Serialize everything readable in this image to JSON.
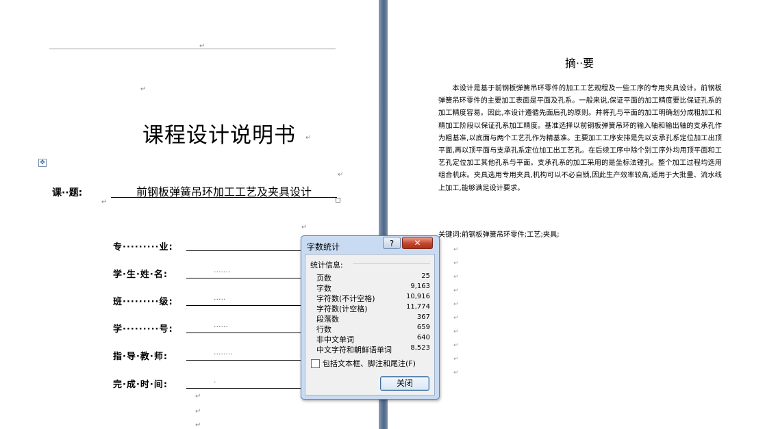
{
  "left_page": {
    "title": "课程设计说明书",
    "topic_label": "课··题:",
    "topic_value": "前钢板弹簧吊环加工工艺及夹具设计",
    "fields": [
      {
        "label": "专·········业:",
        "dots": ""
      },
      {
        "label": "学·生·姓·名:",
        "dots": "·······"
      },
      {
        "label": "班·········级:",
        "dots": "·····"
      },
      {
        "label": "学·········号:",
        "dots": "······"
      },
      {
        "label": "指·导·教·师:",
        "dots": "········"
      },
      {
        "label": "完·成·时·间:",
        "dots": "·"
      }
    ]
  },
  "right_page": {
    "abstract_title": "摘··要",
    "abstract_body": "本设计是基于前钢板弹簧吊环零件的加工工艺规程及一些工序的专用夹具设计。前钢板弹簧吊环零件的主要加工表面是平面及孔系。一般来说,保证平面的加工精度要比保证孔系的加工精度容易。因此,本设计遵循先面后孔的原则。并将孔与平面的加工明确划分成粗加工和精加工阶段以保证孔系加工精度。基准选择以前钢板弹簧吊环的输入轴和输出轴的支承孔作为粗基准,以底面与两个工艺孔作为精基准。主要加工工序安排是先以支承孔系定位加工出顶平面,再以顶平面与支承孔系定位加工出工艺孔。在后续工序中除个别工序外均用顶平面和工艺孔定位加工其他孔系与平面。支承孔系的加工采用的是坐标法镗孔。整个加工过程均选用组合机床。夹具选用专用夹具,机构可以不必自锁,因此生产效率较高,适用于大批量、流水线上加工,能够满足设计要求。",
    "keywords": "关键词:前钢板弹簧吊环零件;工艺;夹具;"
  },
  "dialog": {
    "title": "字数统计",
    "help_label": "?",
    "close_x": "✕",
    "group_label": "统计信息:",
    "stats": [
      {
        "label": "页数",
        "value": "25"
      },
      {
        "label": "字数",
        "value": "9,163"
      },
      {
        "label": "字符数(不计空格)",
        "value": "10,916"
      },
      {
        "label": "字符数(计空格)",
        "value": "11,774"
      },
      {
        "label": "段落数",
        "value": "367"
      },
      {
        "label": "行数",
        "value": "659"
      },
      {
        "label": "非中文单词",
        "value": "640"
      },
      {
        "label": "中文字符和朝鲜语单词",
        "value": "8,523"
      }
    ],
    "checkbox_label": "包括文本框、脚注和尾注(F)",
    "checkbox_checked": false,
    "close_button": "关闭"
  }
}
